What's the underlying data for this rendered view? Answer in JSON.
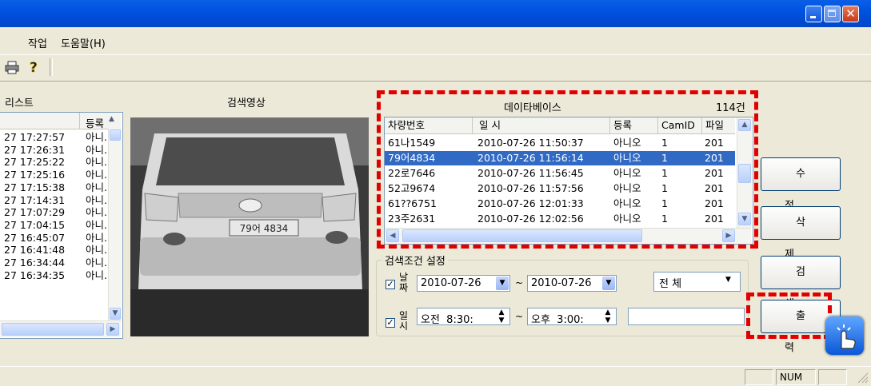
{
  "menu": {
    "items": [
      "작업",
      "도움말(H)"
    ]
  },
  "sections": {
    "list_title": "리스트",
    "video_title": "검색영상"
  },
  "left_list": {
    "col_time_header": "",
    "col_reg_header": "등록",
    "rows": [
      {
        "time": "27 17:27:57",
        "reg": "아니."
      },
      {
        "time": "27 17:26:31",
        "reg": "아니."
      },
      {
        "time": "27 17:25:22",
        "reg": "아니."
      },
      {
        "time": "27 17:25:16",
        "reg": "아니."
      },
      {
        "time": "27 17:15:38",
        "reg": "아니."
      },
      {
        "time": "27 17:14:31",
        "reg": "아니."
      },
      {
        "time": "27 17:07:29",
        "reg": "아니."
      },
      {
        "time": "27 17:04:15",
        "reg": "아니."
      },
      {
        "time": "27 16:45:07",
        "reg": "아니."
      },
      {
        "time": "27 16:41:48",
        "reg": "아니."
      },
      {
        "time": "27 16:34:44",
        "reg": "아니."
      },
      {
        "time": "27 16:34:35",
        "reg": "아니."
      }
    ]
  },
  "photo": {
    "plate_text": "79어 4834"
  },
  "database": {
    "title": "데이타베이스",
    "count": "114건",
    "headers": [
      "차량번호",
      "일    시",
      "등록",
      "CamID",
      "파일"
    ],
    "rows": [
      {
        "plate": "61나1549",
        "datetime": "2010-07-26 11:50:37",
        "reg": "아니오",
        "camid": "1",
        "file": "201",
        "selected": false
      },
      {
        "plate": "79어4834",
        "datetime": "2010-07-26 11:56:14",
        "reg": "아니오",
        "camid": "1",
        "file": "201",
        "selected": true
      },
      {
        "plate": "22로7646",
        "datetime": "2010-07-26 11:56:45",
        "reg": "아니오",
        "camid": "1",
        "file": "201",
        "selected": false
      },
      {
        "plate": "52고9674",
        "datetime": "2010-07-26 11:57:56",
        "reg": "아니오",
        "camid": "1",
        "file": "201",
        "selected": false
      },
      {
        "plate": "61??6751",
        "datetime": "2010-07-26 12:01:33",
        "reg": "아니오",
        "camid": "1",
        "file": "201",
        "selected": false
      },
      {
        "plate": "23주2631",
        "datetime": "2010-07-26 12:02:56",
        "reg": "아니오",
        "camid": "1",
        "file": "201",
        "selected": false
      }
    ]
  },
  "search": {
    "group_title": "검색조건 설정",
    "date_label": "날짜",
    "time_label": "일시",
    "date_from": "2010-07-26",
    "date_to": "2010-07-26",
    "tilde": "~",
    "time_from": "오전  8:30:",
    "time_to": "오후  3:00:",
    "filter_value": "전    체",
    "keyword_value": ""
  },
  "buttons": {
    "edit": "수정",
    "delete": "삭제",
    "search": "검색",
    "print": "출력"
  },
  "status": {
    "num": "NUM"
  },
  "colors": {
    "title_bar": "#0052e0",
    "selection": "#316ac5",
    "highlight_dash": "#e00000"
  }
}
